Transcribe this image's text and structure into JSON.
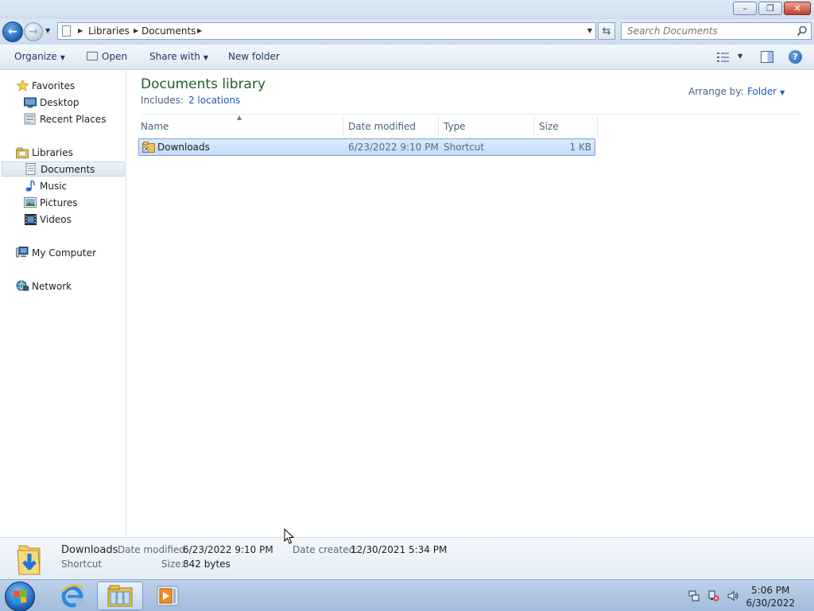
{
  "window": {
    "minimize_glyph": "–",
    "restore_glyph": "❐",
    "close_glyph": "✕"
  },
  "address": {
    "crumbs": [
      "Libraries",
      "Documents"
    ],
    "search_placeholder": "Search Documents"
  },
  "toolbar": {
    "organize": "Organize",
    "open": "Open",
    "share_with": "Share with",
    "new_folder": "New folder"
  },
  "nav": {
    "favorites": "Favorites",
    "desktop": "Desktop",
    "recent_places": "Recent Places",
    "libraries": "Libraries",
    "documents": "Documents",
    "music": "Music",
    "pictures": "Pictures",
    "videos": "Videos",
    "my_computer": "My Computer",
    "network": "Network"
  },
  "library": {
    "title": "Documents library",
    "includes_label": "Includes:",
    "includes_link": "2 locations",
    "arrange_label": "Arrange by:",
    "arrange_value": "Folder"
  },
  "columns": [
    "Name",
    "Date modified",
    "Type",
    "Size"
  ],
  "files": [
    {
      "name": "Downloads",
      "date_modified": "6/23/2022 9:10 PM",
      "type": "Shortcut",
      "size": "1 KB"
    }
  ],
  "details": {
    "name": "Downloads",
    "kind": "Shortcut",
    "date_modified_label": "Date modified:",
    "date_modified": "6/23/2022 9:10 PM",
    "date_created_label": "Date created:",
    "date_created": "12/30/2021 5:34 PM",
    "size_label": "Size:",
    "size": "842 bytes"
  },
  "taskbar": {
    "time": "5:06 PM",
    "date": "6/30/2022"
  },
  "colors": {
    "library_title": "#1e5e29",
    "link": "#1b58b8",
    "selection": "#c1dcfc"
  }
}
